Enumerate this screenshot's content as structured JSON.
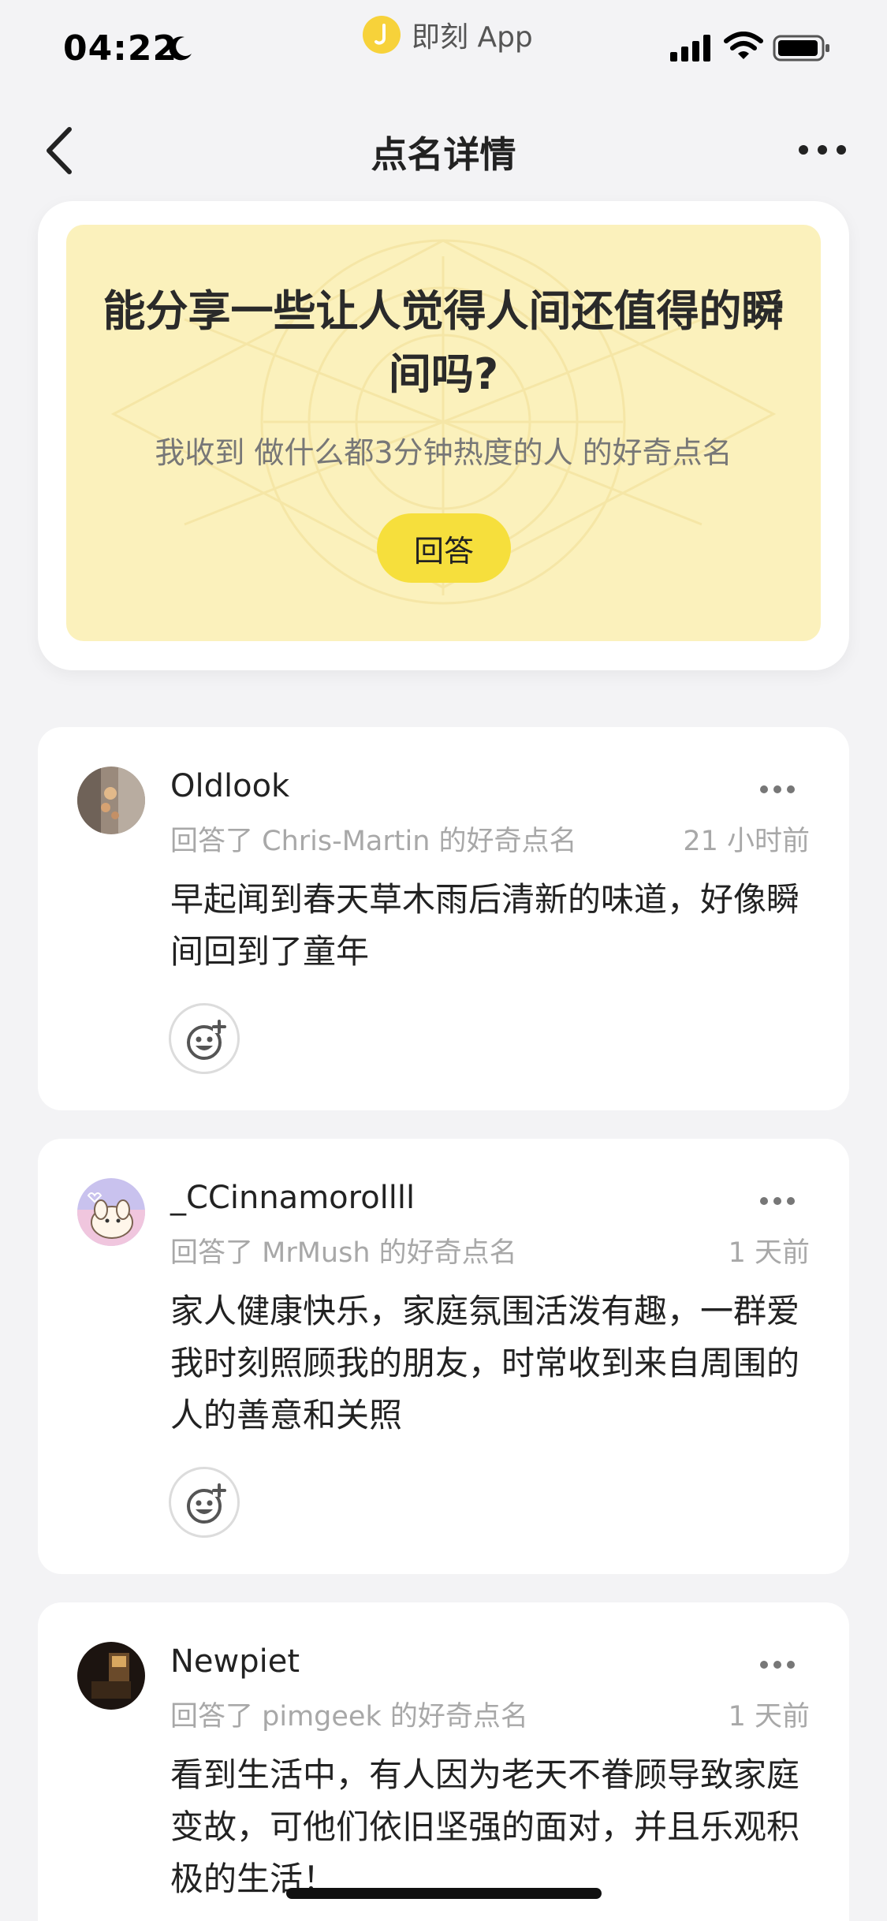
{
  "status_bar": {
    "time": "04:22",
    "app_name": "即刻 App"
  },
  "nav": {
    "title": "点名详情"
  },
  "header": {
    "question": "能分享一些让人觉得人间还值得的瞬间吗?",
    "subtitle": "我收到 做什么都3分钟热度的人 的好奇点名",
    "answer_label": "回答"
  },
  "answers": [
    {
      "username": "Oldlook",
      "meta": "回答了 Chris-Martin 的好奇点名",
      "time": "21 小时前",
      "content": "早起闻到春天草木雨后清新的味道，好像瞬间回到了童年"
    },
    {
      "username": "_CCinnamorollll",
      "meta": "回答了 MrMush 的好奇点名",
      "time": "1 天前",
      "content": "家人健康快乐，家庭氛围活泼有趣，一群爱我时刻照顾我的朋友，时常收到来自周围的人的善意和关照"
    },
    {
      "username": "Newpiet",
      "meta": "回答了 pimgeek 的好奇点名",
      "time": "1 天前",
      "content": "看到生活中，有人因为老天不眷顾导致家庭变故，可他们依旧坚强的面对，并且乐观积极的生活！"
    }
  ],
  "colors": {
    "accent_yellow": "#f6df3c",
    "header_bg": "#fbf1bc",
    "page_bg": "#f3f3f5"
  },
  "icons": [
    "moon-icon",
    "signal-icon",
    "wifi-icon",
    "battery-icon",
    "back-icon",
    "more-icon",
    "add-reaction-icon"
  ]
}
